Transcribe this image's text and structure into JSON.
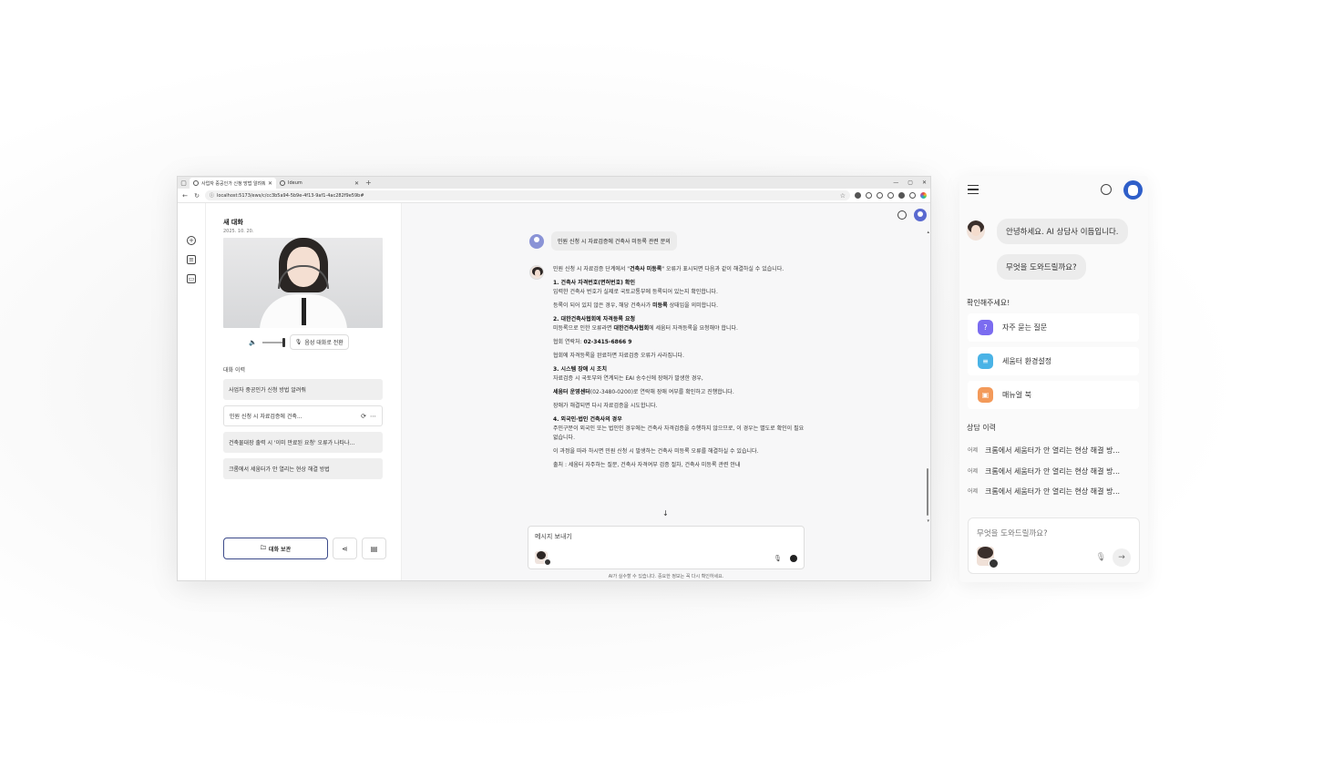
{
  "browser": {
    "tabs": [
      {
        "title": "사업자 중공인가 신청 방법 알려줘",
        "active": true
      },
      {
        "title": "Ideum",
        "active": false
      }
    ],
    "new_tab": "+",
    "window_controls": [
      "—",
      "▢",
      "✕"
    ],
    "url": "localhost:5173/ews/c/cc3b5a94-5b9e-4f13-9af1-4ac282f9e59b#"
  },
  "rail": {
    "icons": [
      "new-chat-icon",
      "notes-icon",
      "archive-icon"
    ]
  },
  "left_panel": {
    "title": "새 대화",
    "date": "2025. 10. 20.",
    "voice_button": "음성 대화로 전환",
    "history_title": "대화 이력",
    "history": [
      "사업자 중공인가 신청 방법 알려줘",
      "민원 신청 시 자료검증에 건축...",
      "건축물대장 출력 시 '이미 만료된 요청' 오류가 나타나...",
      "크롬에서 세움터가 안 열리는 현상 해결 방법"
    ],
    "save_button": "대화 보관"
  },
  "chat": {
    "user_message": "민원 신청 시 자료검증에 건축사 미등록 관련 문의",
    "intro_pre": "민원 신청 시 자료검증 단계에서 \"",
    "intro_bold": "건축사 미등록",
    "intro_post": "\" 오류가 표시되면 다음과 같이 해결하실 수 있습니다.",
    "s1_title": "1. 건축사 자격번호(면허번호) 확인",
    "s1_l1": "입력한 건축사 번호가 실제로 국토교통부에 등록되어 있는지 확인합니다.",
    "s1_l2_pre": "등록이 되어 있지 않은 경우, 해당 건축사가 ",
    "s1_l2_bold": "미등록",
    "s1_l2_post": " 상태임을 의미합니다.",
    "s2_title": "2. 대한건축사협회에 자격등록 요청",
    "s2_l1_pre": "미등록으로 인한 오류라면 ",
    "s2_l1_bold": "대한건축사협회",
    "s2_l1_post": "에 세움터 자격등록을 요청해야 합니다.",
    "s2_l2_pre": "협회 연락처: ",
    "s2_l2_bold": "02-3415-6866 9",
    "s2_l3": "협회에 자격등록을 완료하면 자료검증 오류가 사라집니다.",
    "s3_title": "3. 시스템 장애 시 조치",
    "s3_l1": "자료검증 시 국토부와 연계되는 EAI 송수신에 장애가 발생한 경우,",
    "s3_l2_bold": "세움터 운영센터",
    "s3_l2_post": "(02-3480-0200)로 연락해 장애 여부를 확인하고 진행합니다.",
    "s3_l3": "장애가 해결되면 다시 자료검증을 시도합니다.",
    "s4_title": "4. 외국인·법인 건축사의 경우",
    "s4_l1": "주민구분이 외국인 또는 법인인 경우에는 건축사 자격검증을 수행하지 않으므로, 이 경우는 별도로 확인이 필요 없습니다.",
    "summary": "이 과정을 따라 하시면 민원 신청 시 발생하는 건축사 미등록 오류를 해결하실 수 있습니다.",
    "source": "출처 : 세움터 자주하는 질문, 건축사 자격여부 검증 절차, 건축사 미등록 관련 안내",
    "input_placeholder": "메시지 보내기",
    "disclaimer": "AI가 실수할 수 있습니다. 중요한 정보는 꼭 다시 확인하세요."
  },
  "widget": {
    "greeting": "안녕하세요. AI 상담사 이듬입니다.",
    "question": "무엇을 도와드릴까요?",
    "check_title": "확인해주세요!",
    "menu": [
      {
        "label": "자주 묻는 질문",
        "icon": "faq-icon",
        "color": "#7b6cf0"
      },
      {
        "label": "세움터 환경설정",
        "icon": "settings-icon",
        "color": "#4ab3e6"
      },
      {
        "label": "매뉴얼 북",
        "icon": "manual-book-icon",
        "color": "#f39a5a"
      }
    ],
    "history_title": "상담 이력",
    "history": [
      {
        "date": "어제",
        "title": "크롬에서 세움터가 안 열리는 현상 해결 방..."
      },
      {
        "date": "어제",
        "title": "크롬에서 세움터가 안 열리는 현상 해결 방..."
      },
      {
        "date": "어제",
        "title": "크롬에서 세움터가 안 열리는 현상 해결 방..."
      }
    ],
    "input_placeholder": "무엇을 도와드릴까요?"
  }
}
